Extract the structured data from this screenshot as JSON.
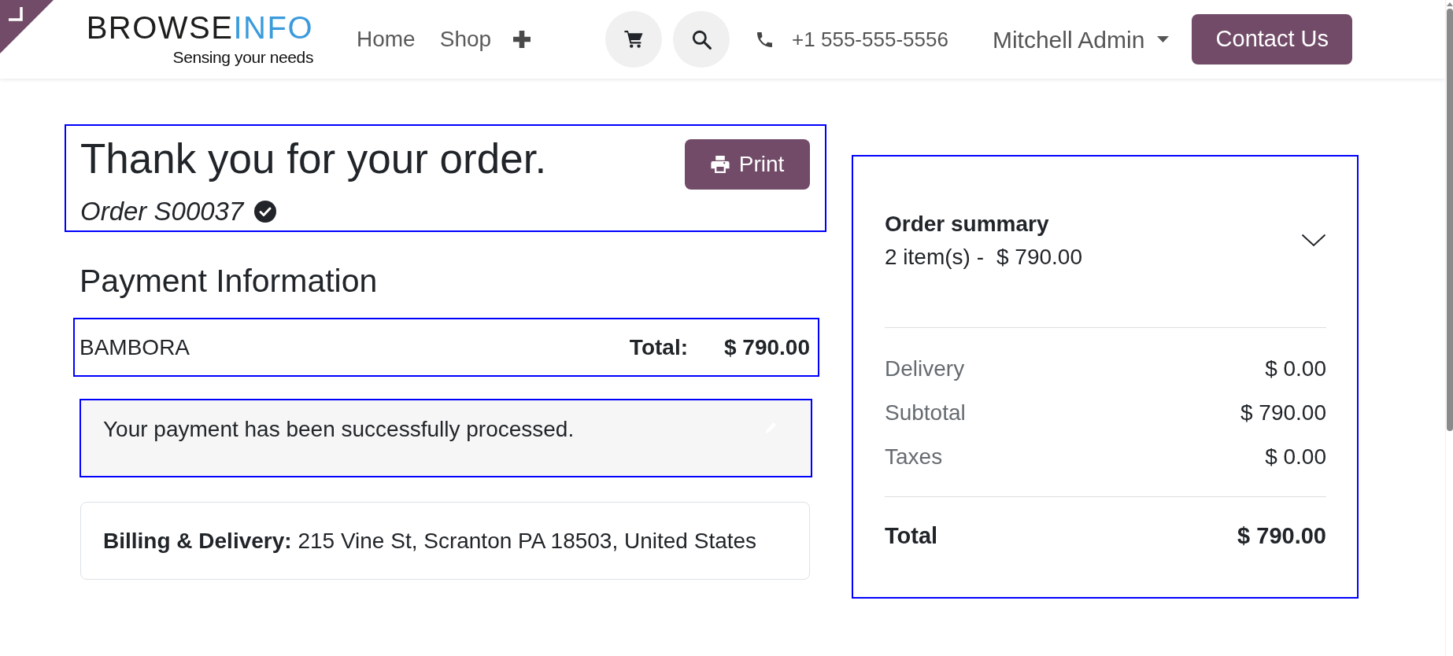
{
  "header": {
    "logo": {
      "dark_part": "BROWSE",
      "light_part": "INFO",
      "tagline": "Sensing your needs"
    },
    "nav": [
      {
        "label": "Home"
      },
      {
        "label": "Shop"
      }
    ],
    "phone": "+1 555-555-5556",
    "user": "Mitchell Admin",
    "contact_button": "Contact Us"
  },
  "order": {
    "outlined": true,
    "title": "Thank you for your order.",
    "print_button": "Print",
    "order_ref": "Order S00037",
    "confirmed": true
  },
  "payment": {
    "heading": "Payment Information",
    "outlined": true,
    "method": "BAMBORA",
    "total_label": "Total:",
    "total": "$ 790.00"
  },
  "alert": {
    "outlined": true,
    "message": "Your payment has been successfully processed."
  },
  "address": {
    "text": "**Billing & Delivery:** 215 Vine St, Scranton PA 18503, United States"
  },
  "summary": {
    "outlined": true,
    "title": "Order summary",
    "items_label": "2 item(s) -",
    "items_amount": "$ 790.00",
    "expanded": false,
    "lines": [
      {
        "label": "Delivery",
        "value": "$ 0.00"
      },
      {
        "label": "Subtotal",
        "value": "$ 790.00"
      },
      {
        "label": "Taxes",
        "value": "$ 0.00"
      }
    ],
    "total_label": "Total",
    "total": "$ 790.00"
  }
}
